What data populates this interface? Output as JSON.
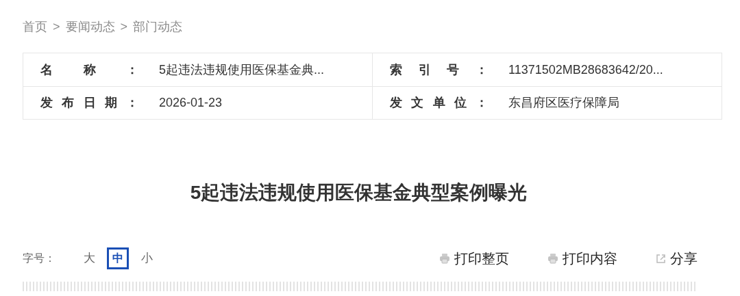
{
  "breadcrumb": [
    "首页",
    "要闻动态",
    "部门动态"
  ],
  "breadcrumb_separator": ">",
  "info_table": [
    [
      {
        "label": "名称：",
        "value": "5起违法违规使用医保基金典..."
      },
      {
        "label": "索引号：",
        "value": "11371502MB28683642/20..."
      }
    ],
    [
      {
        "label": "发布日期：",
        "value": "2026-01-23"
      },
      {
        "label": "发文单位：",
        "value": "东昌府区医疗保障局"
      }
    ]
  ],
  "title": "5起违法违规使用医保基金典型案例曝光",
  "font_size": {
    "label": "字号：",
    "options": [
      {
        "label": "大",
        "selected": false
      },
      {
        "label": "中",
        "selected": true
      },
      {
        "label": "小",
        "selected": false
      }
    ]
  },
  "actions": [
    {
      "kind": "print",
      "label": "打印整页"
    },
    {
      "kind": "print",
      "label": "打印内容"
    },
    {
      "kind": "share",
      "label": "分享"
    }
  ]
}
